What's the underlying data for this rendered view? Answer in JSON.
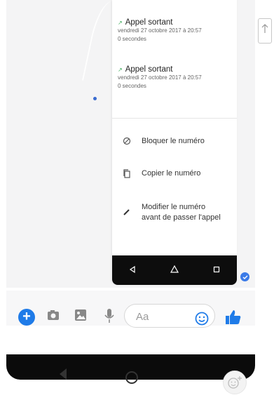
{
  "calls": [
    {
      "title": "Appel sortant",
      "date": "vendredi 27 octobre 2017 à 20:57",
      "duration": "0 secondes"
    },
    {
      "title": "Appel sortant",
      "date": "vendredi 27 octobre 2017 à 20:57",
      "duration": "0 secondes"
    }
  ],
  "menu": {
    "block": {
      "label": "Bloquer le numéro",
      "icon": "block-icon"
    },
    "copy": {
      "label": "Copier le numéro",
      "icon": "copy-icon"
    },
    "edit": {
      "label": "Modifier le numéro avant de passer l'appel",
      "icon": "pencil-icon"
    }
  },
  "composer": {
    "placeholder": "Aa",
    "icons": [
      "plus-icon",
      "camera-icon",
      "gallery-icon",
      "microphone-icon",
      "emoji-icon",
      "thumbs-up-icon"
    ]
  },
  "colors": {
    "accent": "#1f7be8",
    "navbar": "#0d0d0d",
    "call_arrow": "#35a853"
  }
}
